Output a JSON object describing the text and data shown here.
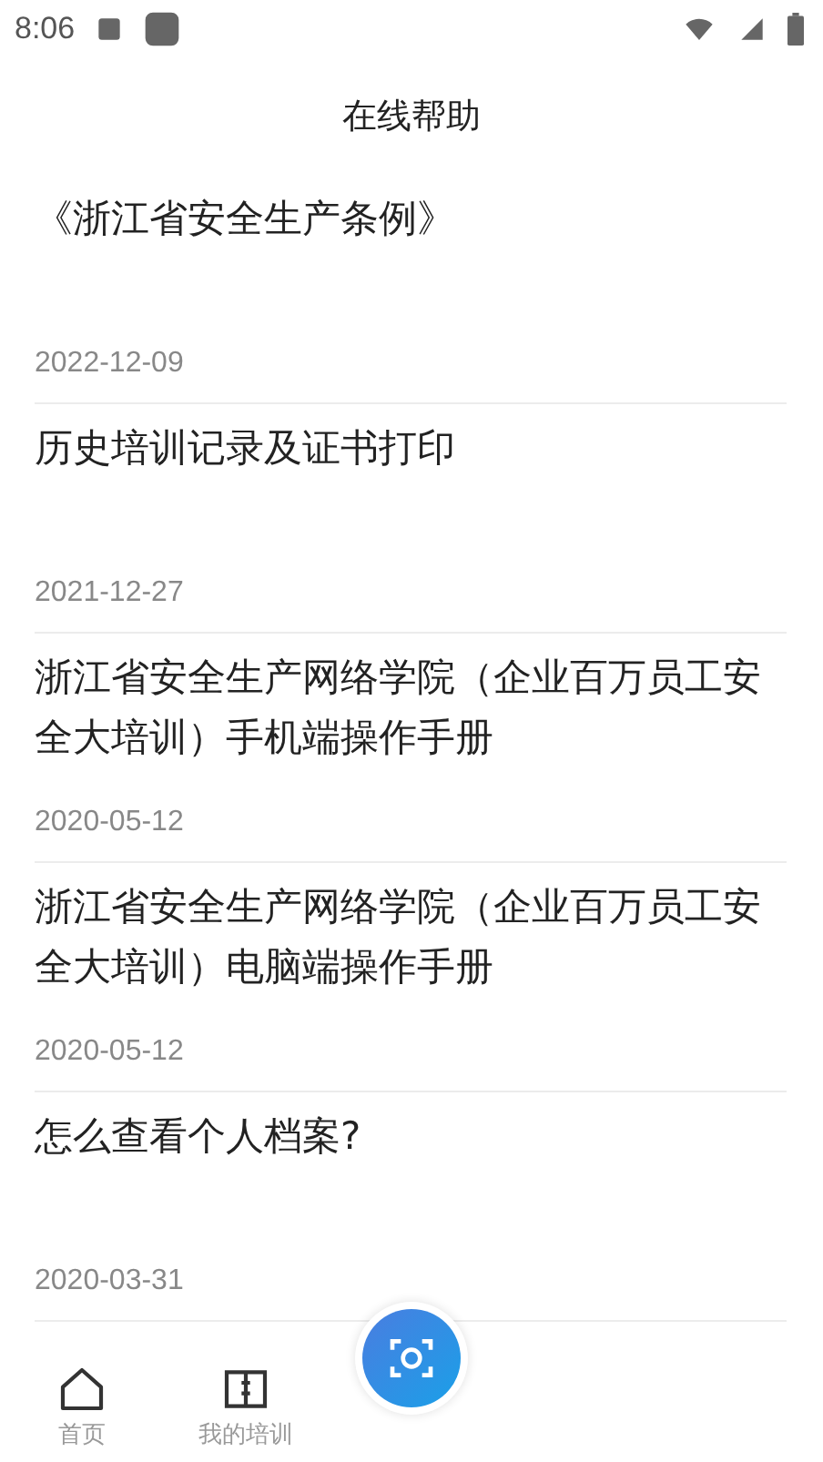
{
  "status_bar": {
    "time": "8:06"
  },
  "header": {
    "title": "在线帮助"
  },
  "articles": [
    {
      "title": "《浙江省安全生产条例》",
      "date": "2022-12-09"
    },
    {
      "title": "历史培训记录及证书打印",
      "date": "2021-12-27"
    },
    {
      "title": "浙江省安全生产网络学院（企业百万员工安全大培训）手机端操作手册",
      "date": "2020-05-12"
    },
    {
      "title": "浙江省安全生产网络学院（企业百万员工安全大培训）电脑端操作手册",
      "date": "2020-05-12"
    },
    {
      "title": "怎么查看个人档案?",
      "date": "2020-03-31"
    }
  ],
  "bottom_nav": [
    {
      "kind": "home",
      "label": "首页"
    },
    {
      "kind": "book",
      "label": "我的培训"
    },
    {
      "kind": "scan"
    }
  ]
}
